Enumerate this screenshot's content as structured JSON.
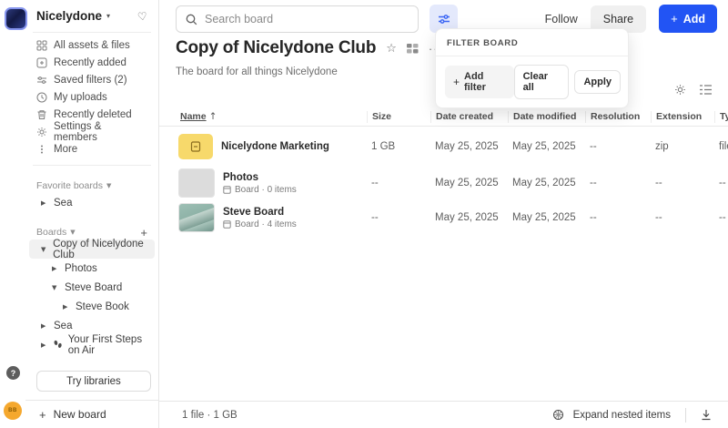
{
  "workspace": {
    "name": "Nicelydone"
  },
  "sidebar": {
    "nav": [
      {
        "label": "All assets & files",
        "icon": "assets-grid-icon"
      },
      {
        "label": "Recently added",
        "icon": "plus-square-icon"
      },
      {
        "label": "Saved filters (2)",
        "icon": "sliders-icon"
      },
      {
        "label": "My uploads",
        "icon": "clock-icon"
      },
      {
        "label": "Recently deleted",
        "icon": "trash-icon"
      },
      {
        "label": "Settings & members",
        "icon": "gear-icon"
      },
      {
        "label": "More",
        "icon": "kebab-icon"
      }
    ],
    "favorites_header": "Favorite boards",
    "favorites": [
      {
        "label": "Sea"
      }
    ],
    "boards_header": "Boards",
    "boards": [
      {
        "label": "Copy of Nicelydone Club",
        "selected": true
      },
      {
        "label": "Photos"
      },
      {
        "label": "Steve Board"
      },
      {
        "label": "Steve Book"
      },
      {
        "label": "Sea"
      },
      {
        "label": "Your First Steps on Air",
        "icon": "footsteps-icon"
      }
    ],
    "try_libraries": "Try libraries",
    "new_board": "New board"
  },
  "topbar": {
    "search_placeholder": "Search board",
    "follow": "Follow",
    "share": "Share",
    "add": "Add"
  },
  "board": {
    "title": "Copy of  Nicelydone Club",
    "description": "The board for all things Nicelydone"
  },
  "filter_panel": {
    "title": "FILTER BOARD",
    "add_filter": "Add filter",
    "clear_all": "Clear all",
    "apply": "Apply"
  },
  "table": {
    "columns": [
      "Name",
      "Size",
      "Date created",
      "Date modified",
      "Resolution",
      "Extension",
      "Type"
    ],
    "sort": {
      "column": "Name",
      "direction": "asc"
    },
    "rows": [
      {
        "name": "Nicelydone Marketing",
        "size": "1 GB",
        "date_created": "May 25, 2025",
        "date_modified": "May 25, 2025",
        "resolution": "--",
        "extension": "zip",
        "type": "file"
      },
      {
        "name": "Photos",
        "subtitle": "Board · 0 items",
        "size": "--",
        "date_created": "May 25, 2025",
        "date_modified": "May 25, 2025",
        "resolution": "--",
        "extension": "--",
        "type": "--"
      },
      {
        "name": "Steve Board",
        "subtitle": "Board · 4 items",
        "size": "--",
        "date_created": "May 25, 2025",
        "date_modified": "May 25, 2025",
        "resolution": "--",
        "extension": "--",
        "type": "--"
      }
    ]
  },
  "footer": {
    "summary": "1 file · 1 GB",
    "expand_nested": "Expand nested items"
  },
  "user": {
    "initials": "BB"
  },
  "colors": {
    "accent": "#2254f4",
    "filter_active_bg": "#e4e9fc",
    "thumb_yellow": "#f7d96b",
    "avatar": "#f5a82e"
  }
}
